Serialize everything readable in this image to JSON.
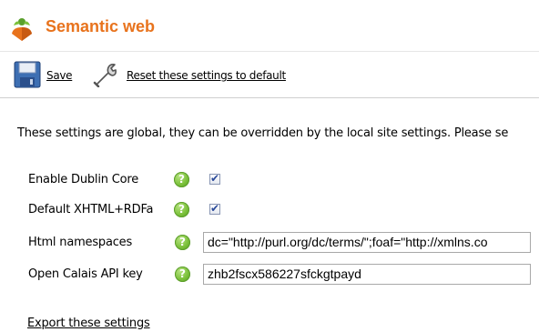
{
  "header": {
    "title": "Semantic web",
    "icon": "semantic-web-logo-icon",
    "title_color": "#e8731d"
  },
  "toolbar": {
    "save_label": "Save",
    "save_icon": "floppy-disk-icon",
    "reset_label": "Reset these settings to default",
    "reset_icon": "wrench-icon"
  },
  "info_text": "These settings are global, they can be overridden by the local site settings. Please se",
  "settings": [
    {
      "label": "Enable Dublin Core",
      "type": "checkbox",
      "checked": true
    },
    {
      "label": "Default XHTML+RDFa",
      "type": "checkbox",
      "checked": true
    },
    {
      "label": "Html namespaces",
      "type": "text",
      "value": "dc=\"http://purl.org/dc/terms/\";foaf=\"http://xmlns.co"
    },
    {
      "label": "Open Calais API key",
      "type": "text",
      "value": "zhb2fscx586227sfckgtpayd"
    }
  ],
  "help_icon": "help-icon",
  "export_label": "Export these settings"
}
